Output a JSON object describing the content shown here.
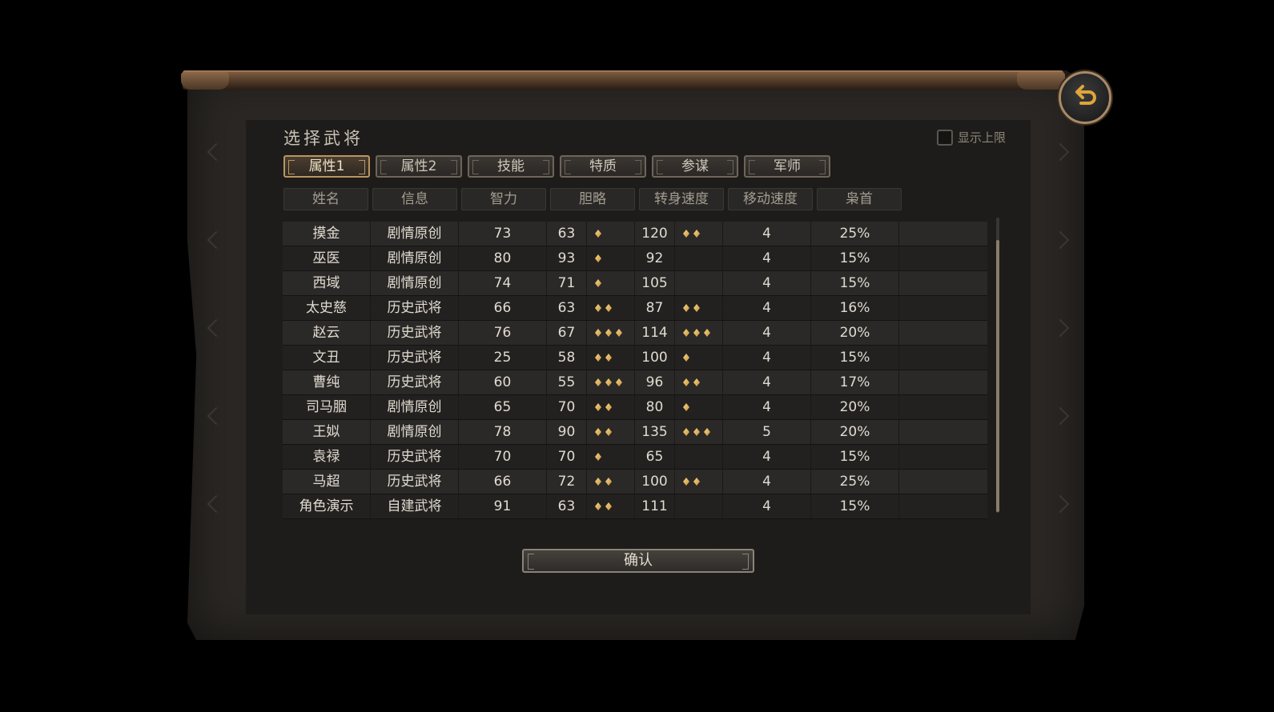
{
  "title": "选择武将",
  "show_limit_label": "显示上限",
  "tabs": [
    {
      "label": "属性1",
      "active": true
    },
    {
      "label": "属性2",
      "active": false
    },
    {
      "label": "技能",
      "active": false
    },
    {
      "label": "特质",
      "active": false
    },
    {
      "label": "参谋",
      "active": false
    },
    {
      "label": "军师",
      "active": false
    }
  ],
  "columns": [
    "姓名",
    "信息",
    "智力",
    "胆略",
    "转身速度",
    "移动速度",
    "枭首"
  ],
  "rows": [
    {
      "name": "摸金",
      "info": "剧情原创",
      "int": "73",
      "bold": "63",
      "bold_gems": 1,
      "turn": "120",
      "turn_gems": 2,
      "move": "4",
      "kill": "25%"
    },
    {
      "name": "巫医",
      "info": "剧情原创",
      "int": "80",
      "bold": "93",
      "bold_gems": 1,
      "turn": "92",
      "turn_gems": 0,
      "move": "4",
      "kill": "15%"
    },
    {
      "name": "西域",
      "info": "剧情原创",
      "int": "74",
      "bold": "71",
      "bold_gems": 1,
      "turn": "105",
      "turn_gems": 0,
      "move": "4",
      "kill": "15%"
    },
    {
      "name": "太史慈",
      "info": "历史武将",
      "int": "66",
      "bold": "63",
      "bold_gems": 2,
      "turn": "87",
      "turn_gems": 2,
      "move": "4",
      "kill": "16%"
    },
    {
      "name": "赵云",
      "info": "历史武将",
      "int": "76",
      "bold": "67",
      "bold_gems": 3,
      "turn": "114",
      "turn_gems": 3,
      "move": "4",
      "kill": "20%"
    },
    {
      "name": "文丑",
      "info": "历史武将",
      "int": "25",
      "bold": "58",
      "bold_gems": 2,
      "turn": "100",
      "turn_gems": 1,
      "move": "4",
      "kill": "15%"
    },
    {
      "name": "曹纯",
      "info": "历史武将",
      "int": "60",
      "bold": "55",
      "bold_gems": 3,
      "turn": "96",
      "turn_gems": 2,
      "move": "4",
      "kill": "17%"
    },
    {
      "name": "司马胭",
      "info": "剧情原创",
      "int": "65",
      "bold": "70",
      "bold_gems": 2,
      "turn": "80",
      "turn_gems": 1,
      "move": "4",
      "kill": "20%"
    },
    {
      "name": "王姒",
      "info": "剧情原创",
      "int": "78",
      "bold": "90",
      "bold_gems": 2,
      "turn": "135",
      "turn_gems": 3,
      "move": "5",
      "kill": "20%"
    },
    {
      "name": "袁禄",
      "info": "历史武将",
      "int": "70",
      "bold": "70",
      "bold_gems": 1,
      "turn": "65",
      "turn_gems": 0,
      "move": "4",
      "kill": "15%"
    },
    {
      "name": "马超",
      "info": "历史武将",
      "int": "66",
      "bold": "72",
      "bold_gems": 2,
      "turn": "100",
      "turn_gems": 2,
      "move": "4",
      "kill": "25%"
    },
    {
      "name": "角色演示",
      "info": "自建武将",
      "int": "91",
      "bold": "63",
      "bold_gems": 2,
      "turn": "111",
      "turn_gems": 0,
      "move": "4",
      "kill": "15%"
    }
  ],
  "confirm_label": "确认",
  "colors": {
    "accent_gold": "#b8955f",
    "gem": "#e8b860"
  }
}
